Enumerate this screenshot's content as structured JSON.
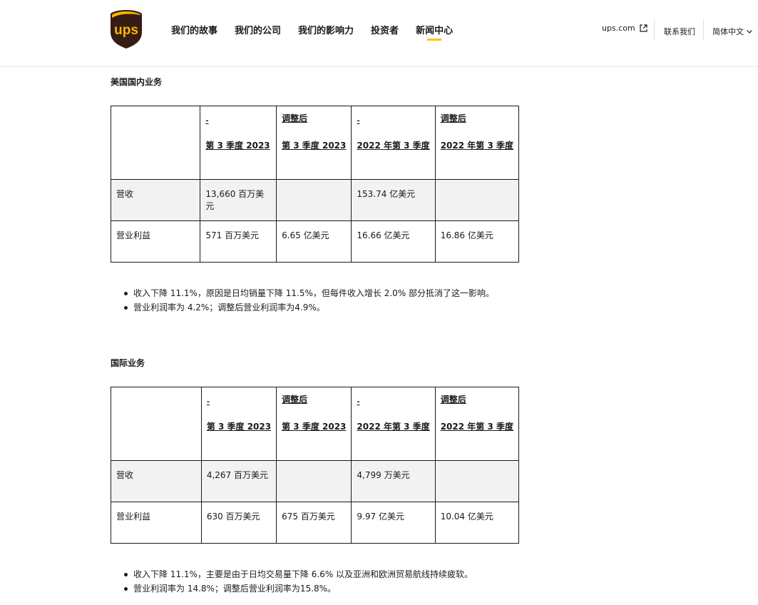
{
  "header": {
    "logo_text": "ups",
    "nav": [
      {
        "label": "我们的故事"
      },
      {
        "label": "我们的公司"
      },
      {
        "label": "我们的影响力"
      },
      {
        "label": "投资者"
      },
      {
        "label": "新闻中心"
      }
    ],
    "ups_link": "ups.com",
    "contact": "联系我们",
    "language": "简体中文",
    "colors": {
      "brand_brown": "#351c15",
      "brand_gold": "#ffb500",
      "accent": "#ffc400"
    }
  },
  "sections": [
    {
      "title": "美国国内业务",
      "columns": [
        {
          "top": "-",
          "main": "第 3 季度 2023"
        },
        {
          "top": "调整后",
          "main": "第 3 季度 2023"
        },
        {
          "top": "-",
          "main": "2022 年第 3 季度"
        },
        {
          "top": "调整后",
          "main": "2022 年第 3 季度"
        }
      ],
      "rows": [
        {
          "label": "营收",
          "values": [
            "13,660 百万美元",
            "",
            "153.74 亿美元",
            ""
          ]
        },
        {
          "label": "营业利益",
          "values": [
            "571 百万美元",
            "6.65 亿美元",
            "16.66 亿美元",
            "16.86 亿美元"
          ]
        }
      ],
      "bullets": [
        "收入下降 11.1%，原因是日均销量下降 11.5%，但每件收入增长 2.0% 部分抵消了这一影响。",
        "营业利润率为 4.2%；调整后营业利润率为4.9%。"
      ]
    },
    {
      "title": "国际业务",
      "columns": [
        {
          "top": "-",
          "main": "第 3 季度 2023"
        },
        {
          "top": "调整后",
          "main": "第 3 季度 2023"
        },
        {
          "top": "-",
          "main": "2022 年第 3 季度"
        },
        {
          "top": "调整后",
          "main": "2022 年第 3 季度"
        }
      ],
      "rows": [
        {
          "label": "营收",
          "values": [
            "4,267 百万美元",
            "",
            "4,799 万美元",
            ""
          ]
        },
        {
          "label": "营业利益",
          "values": [
            "630 百万美元",
            "675 百万美元",
            "9.97 亿美元",
            "10.04 亿美元"
          ]
        }
      ],
      "bullets": [
        "收入下降 11.1%，主要是由于日均交易量下降 6.6% 以及亚洲和欧洲贸易航线持续疲软。",
        "营业利润率为 14.8%；调整后营业利润率为15.8%。"
      ]
    }
  ]
}
